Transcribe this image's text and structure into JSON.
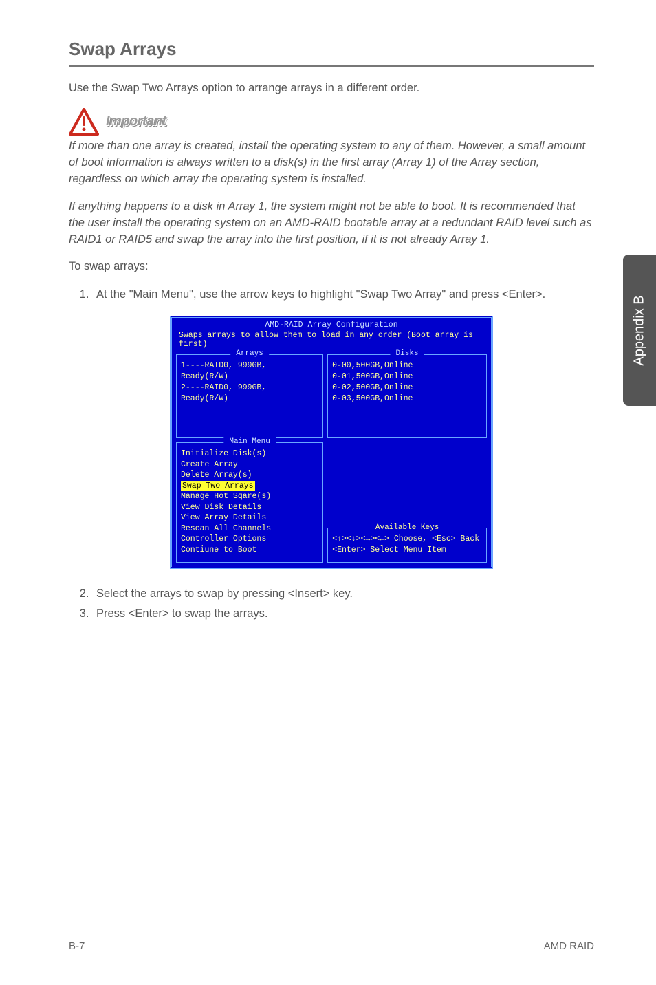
{
  "sideTab": "Appendix B",
  "title": "Swap Arrays",
  "intro": "Use the Swap Two Arrays option to arrange arrays in a different order.",
  "importantLabel": "Important",
  "importantP1": "If more than one array is created, install the operating system to any of them. However, a small amount of boot information is always written to a disk(s) in the first array (Array 1) of the Array section, regardless on which array the operating system is installed.",
  "importantP2": "If anything happens to a disk in Array 1, the system might not be able to boot. It is recommended that the user install the operating system on an AMD-RAID bootable array at a redundant RAID level such as RAID1 or RAID5 and swap the array into the first position, if it is not already Array 1.",
  "toSwap": "To swap arrays:",
  "step1": "At the \"Main Menu\", use the arrow keys to highlight \"Swap Two Array\" and press <Enter>.",
  "step2": "Select the arrays to swap by pressing <Insert> key.",
  "step3": "Press <Enter> to swap the arrays.",
  "bios": {
    "header": "AMD-RAID Array Configuration",
    "sub": "Swaps arrays to allow them to load in any order (Boot array is first)",
    "arraysTitle": "Arrays",
    "disksTitle": "Disks",
    "arrays": [
      "1----RAID0, 999GB, Ready(R/W)",
      "2----RAID0, 999GB, Ready(R/W)"
    ],
    "disks": [
      "0-00,500GB,Online",
      "0-01,500GB,Online",
      "0-02,500GB,Online",
      "0-03,500GB,Online"
    ],
    "mainMenuTitle": "Main Menu",
    "menu": {
      "i0": "Initialize Disk(s)",
      "i1": "Create Array",
      "i2": "Delete Array(s)",
      "i3": "Swap Two Arrays",
      "i4": "Manage Hot Sqare(s)",
      "i5": "View Disk Details",
      "i6": "View Array Details",
      "i7": "Rescan All Channels",
      "i8": "Controller Options",
      "i9": "Contiune to Boot"
    },
    "availTitle": "Available Keys",
    "avail1": "<↑><↓><→><←>=Choose, <Esc>=Back",
    "avail2": "<Enter>=Select Menu Item"
  },
  "footer": {
    "page": "B-7",
    "section": "AMD RAID"
  }
}
